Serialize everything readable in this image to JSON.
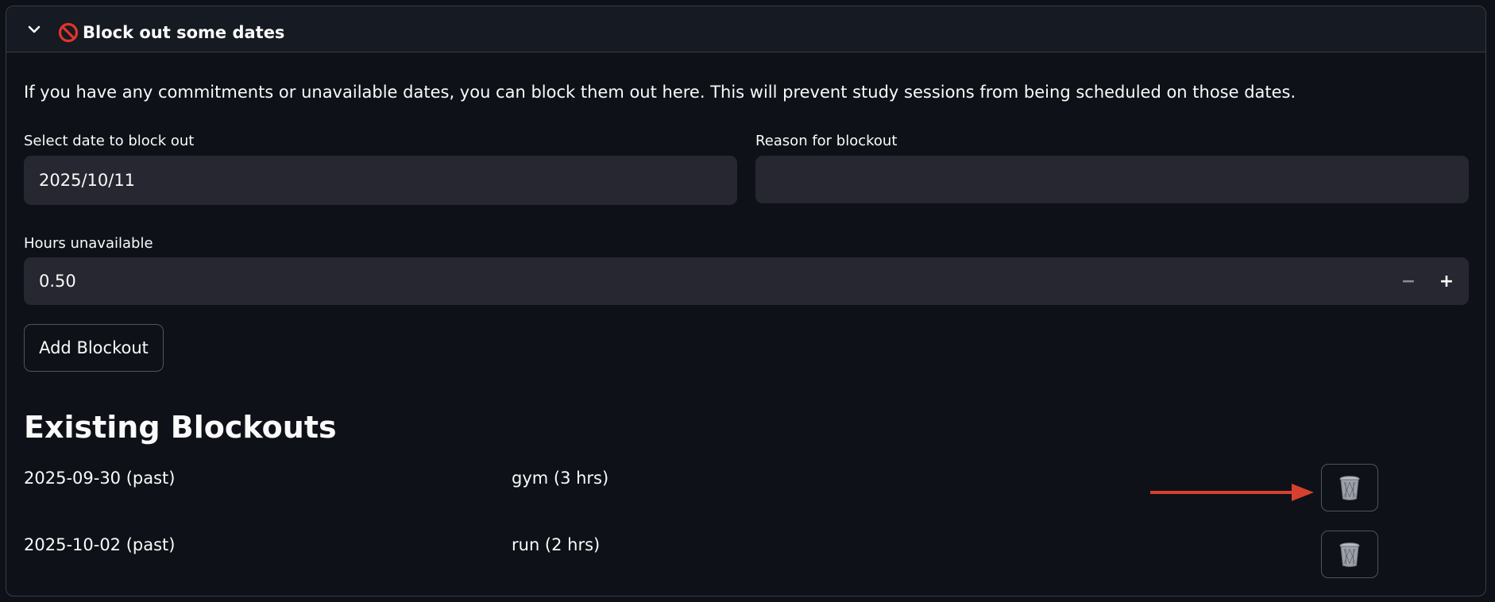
{
  "expander": {
    "title": "Block out some dates",
    "chevron_icon": "chevron-down-icon",
    "title_icon": "no-entry-icon"
  },
  "intro_text": "If you have any commitments or unavailable dates, you can block them out here. This will prevent study sessions from being scheduled on those dates.",
  "form": {
    "date_label": "Select date to block out",
    "date_value": "2025/10/11",
    "reason_label": "Reason for blockout",
    "reason_value": "",
    "hours_label": "Hours unavailable",
    "hours_value": "0.50",
    "minus_label": "−",
    "plus_label": "+",
    "add_button_label": "Add Blockout"
  },
  "blockouts": {
    "heading": "Existing Blockouts",
    "items": [
      {
        "date": "2025-09-30 (past)",
        "reason": "gym (3 hrs)",
        "delete_icon": "trash-icon"
      },
      {
        "date": "2025-10-02 (past)",
        "reason": "run (2 hrs)",
        "delete_icon": "trash-icon"
      }
    ]
  },
  "colors": {
    "background": "#0e1117",
    "field_background": "#262730",
    "annotation_arrow": "#d6402f"
  }
}
